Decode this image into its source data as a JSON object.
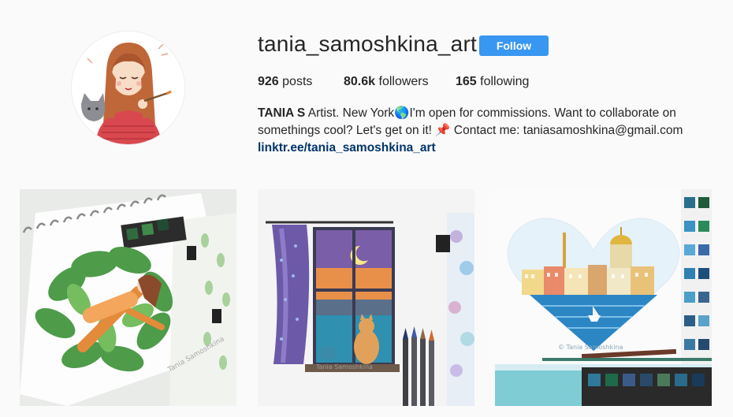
{
  "profile": {
    "username": "tania_samoshkina_art",
    "follow_label": "Follow",
    "stats": {
      "posts_count": "926",
      "posts_label": "posts",
      "followers_count": "80.6k",
      "followers_label": "followers",
      "following_count": "165",
      "following_label": "following"
    },
    "bio": {
      "name": "TANIA S",
      "text_1": " Artist. New York",
      "globe_emoji": "🌎",
      "text_2": "I'm open for commissions. Want to collaborate on somethings cool? Let's get on it! ",
      "pin_emoji": "📌",
      "text_3": "Contact me: taniasamoshkina@gmail.com",
      "link": "linktr.ee/tania_samoshkina_art"
    }
  },
  "posts": [
    {
      "watermark": "Tania Samoshkina"
    },
    {
      "watermark": "Tania Samoshkina"
    },
    {
      "watermark": "© Tania Samoshkina"
    }
  ],
  "colors": {
    "follow_button": "#3897f0",
    "link": "#003569",
    "background": "#fafafa"
  }
}
